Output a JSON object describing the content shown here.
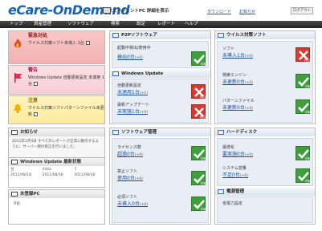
{
  "header": {
    "logo_e": "e",
    "logo_rest": "Care-OnDemand",
    "agent_label": "エージェントPC 詳細を表示",
    "links": [
      "ダウンロード",
      "お知らせ"
    ],
    "logout": "ログアウト"
  },
  "nav": [
    "トップ",
    "資産管理",
    "ソフトウェア",
    "検索",
    "設定",
    "レポート",
    "ヘルプ"
  ],
  "alerts": {
    "urgent": {
      "title": "緊急対処",
      "line": "ウイルス対策ソフト未導入 1台"
    },
    "warning": {
      "title": "警告",
      "line": "Windows Update 自動更新設定 未適用 1台"
    },
    "notice": {
      "title": "注意",
      "line": "ウイルス対策ソフトパターンファイル未更新"
    }
  },
  "notice_box": {
    "title": "お知らせ",
    "text": "2011年1月4日 すべてのレポートが正常に動作するように、サーバー側の修正を行いました。"
  },
  "wu_box": {
    "title": "Windows Update 最新状態",
    "headers": [
      "台",
      "Vista",
      "7"
    ],
    "row": [
      "2011/08/18",
      "2011/08/18",
      "2011/08/18"
    ]
  },
  "unreg_box": {
    "title": "未登録PC",
    "value": "0台"
  },
  "p2p": {
    "title": "P2Pソフトウェア",
    "item1_label": "起動中検出/使用中",
    "item1_value": "検出0台",
    "item1_count": "(+0)"
  },
  "wupdate": {
    "title": "Windows Update",
    "item1_label": "自動更新設定",
    "item1_value": "未適用1台",
    "item1_count": "(+1)",
    "item2_label": "最新アップデート",
    "item2_value": "未実施1台",
    "item2_count": "(+0)"
  },
  "virus": {
    "title": "ウイルス対策ソフト",
    "item1_label": "ソフト",
    "item1_value": "未導入1台",
    "item1_count": "(+0)",
    "item2_label": "検索エンジン",
    "item2_value": "未更新0台",
    "item2_count": "(+0)",
    "item3_label": "パターンファイル",
    "item3_value": "未更新0台",
    "item3_count": "(+0)"
  },
  "soft": {
    "title": "ソフトウェア管理",
    "item1_label": "ライセンス数",
    "item1_value": "超過0台",
    "item1_count": "(+0)",
    "item2_label": "禁止ソフト",
    "item2_value": "使用0台",
    "item2_count": "(+0)",
    "item3_label": "必須ソフト",
    "item3_value": "未導入0台",
    "item3_count": "(+0)"
  },
  "hdd": {
    "title": "ハードディスク",
    "item1_label": "最適化",
    "item1_value": "要実施0台",
    "item1_count": "(+0)",
    "item2_label": "システム容量",
    "item2_value": "不足0台",
    "item2_count": "(+0)"
  },
  "power": {
    "title": "電源管理",
    "item1_label": "省電力設定"
  },
  "status_labels": {
    "ok": "OK",
    "ng": "NG"
  },
  "colors": {
    "accent": "#1a62b5",
    "ok": "#3f9f3c",
    "ng": "#d33a31"
  }
}
